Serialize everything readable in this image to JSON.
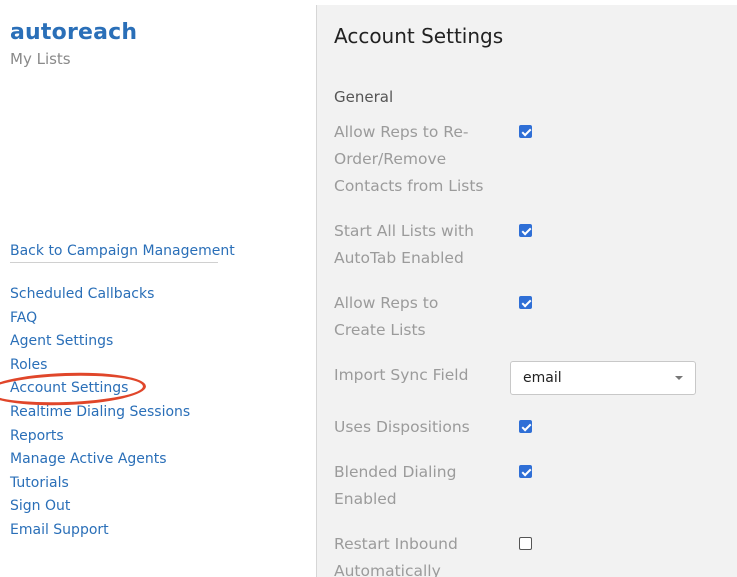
{
  "brand": {
    "logo_text": "autoreach",
    "subtitle": "My Lists"
  },
  "sidebar": {
    "back_link": "Back to Campaign Management",
    "items": [
      {
        "label": "Scheduled Callbacks"
      },
      {
        "label": "FAQ"
      },
      {
        "label": "Agent Settings"
      },
      {
        "label": "Roles"
      },
      {
        "label": "Account Settings"
      },
      {
        "label": "Realtime Dialing Sessions"
      },
      {
        "label": "Reports"
      },
      {
        "label": "Manage Active Agents"
      },
      {
        "label": "Tutorials"
      },
      {
        "label": "Sign Out"
      },
      {
        "label": "Email Support"
      }
    ],
    "highlighted_item": "Account Settings",
    "highlight_color": "#e0462a"
  },
  "main": {
    "title": "Account Settings",
    "section": "General",
    "settings": [
      {
        "label": "Allow Reps to Re-Order/Remove Contacts from Lists",
        "checked": true
      },
      {
        "label": "Start All Lists with AutoTab Enabled",
        "checked": true
      },
      {
        "label": "Allow Reps to Create Lists",
        "checked": true
      },
      {
        "label": "Import Sync Field",
        "type": "select",
        "value": "email"
      },
      {
        "label": "Uses Dispositions",
        "checked": true
      },
      {
        "label": "Blended Dialing Enabled",
        "checked": true
      },
      {
        "label": "Restart Inbound Automatically",
        "checked": false
      }
    ]
  },
  "colors": {
    "link": "#2a6fb8",
    "checkbox_checked": "#2f6fd6",
    "panel_bg": "#f2f2f2"
  }
}
